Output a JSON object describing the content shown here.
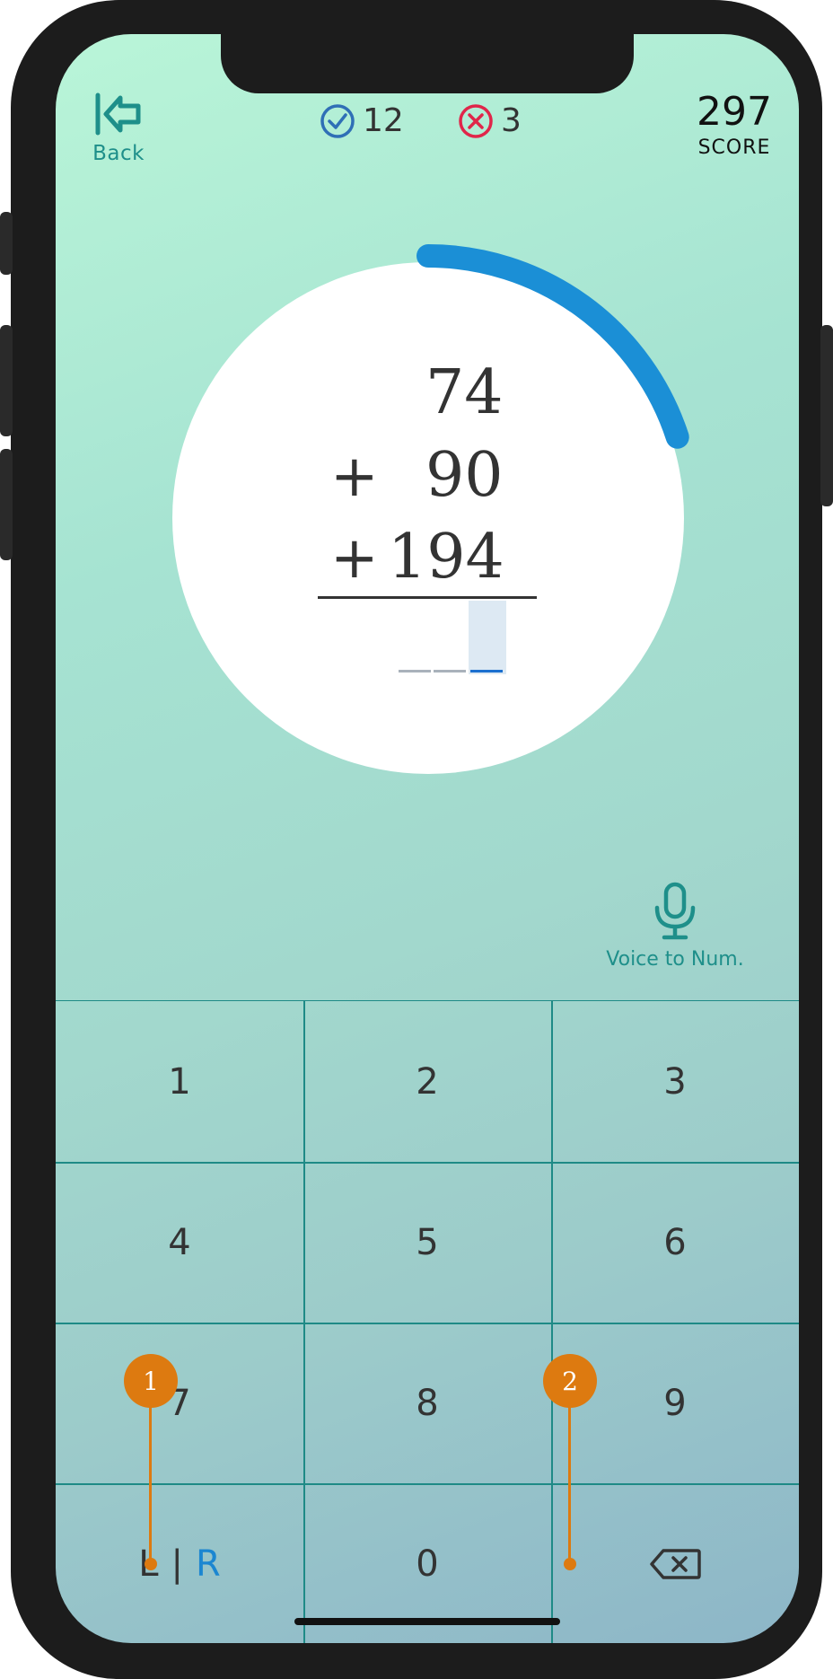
{
  "header": {
    "back_label": "Back",
    "correct_count": "12",
    "wrong_count": "3",
    "score_value": "297",
    "score_label": "SCORE"
  },
  "problem": {
    "operands": [
      "74",
      "90",
      "194"
    ],
    "operators": [
      "+",
      "+"
    ],
    "answer_slots": 3,
    "active_slot_index": 2
  },
  "timer": {
    "progress_fraction": 0.2
  },
  "voice": {
    "label": "Voice to Num."
  },
  "keypad": {
    "keys": [
      "1",
      "2",
      "3",
      "4",
      "5",
      "6",
      "7",
      "8",
      "9"
    ],
    "left_right_l": "L",
    "left_right_sep": "|",
    "left_right_r": "R",
    "zero": "0",
    "backspace_icon": "backspace-icon"
  },
  "callouts": [
    "1",
    "2"
  ],
  "colors": {
    "accent_teal": "#1e8f8a",
    "timer_blue": "#1b8fd6",
    "correct_blue": "#2f6fb6",
    "wrong_red": "#e0264a",
    "callout_orange": "#dd7a10",
    "lr_blue": "#1b86d1"
  }
}
